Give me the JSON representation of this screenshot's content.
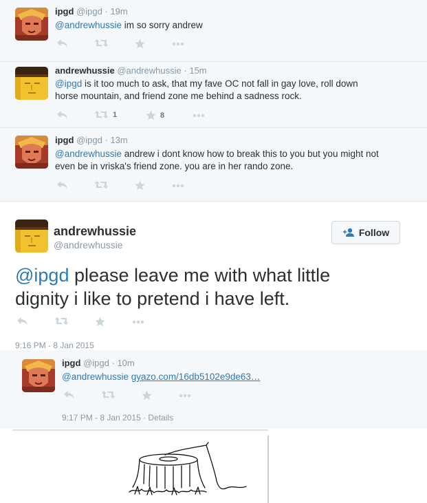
{
  "thread": [
    {
      "name": "ipgd",
      "handle": "@ipgd",
      "time": "19m",
      "mention": "@andrewhussie",
      "text": " im so sorry andrew",
      "retweets": "",
      "favorites": ""
    },
    {
      "name": "andrewhussie",
      "handle": "@andrewhussie",
      "time": "15m",
      "mention": "@ipgd",
      "text_line1": " is it too much to ask, that my fave OC not fall in gay love, roll down",
      "text_line2": "horse mountain, and friend zone me behind a sadness rock.",
      "retweets": "1",
      "favorites": "8"
    },
    {
      "name": "ipgd",
      "handle": "@ipgd",
      "time": "13m",
      "mention": "@andrewhussie",
      "text_line1": " andrew i dont know how to break this to you but you might not",
      "text_line2": "even be in vriska's friend zone. you are in her rando zone.",
      "retweets": "",
      "favorites": ""
    }
  ],
  "main": {
    "name": "andrewhussie",
    "handle": "@andrewhussie",
    "follow_label": "Follow",
    "mention": "@ipgd",
    "text_line1": " please leave me with what little",
    "text_line2": "dignity i like to pretend i have left.",
    "timestamp": "9:16 PM - 8 Jan 2015"
  },
  "reply": {
    "name": "ipgd",
    "handle": "@ipgd",
    "time": "10m",
    "mention": "@andrewhussie",
    "link": "gyazo.com/16db5102e9de63…",
    "timestamp": "9:17 PM - 8 Jan 2015 · Details"
  },
  "colors": {
    "link": "#2b7bb9",
    "muted": "#8899a6",
    "action": "#ccd6dd",
    "thread_bg": "#f5f8fa"
  },
  "icons": [
    "reply-icon",
    "retweet-icon",
    "favorite-icon",
    "more-icon",
    "follow-person-icon"
  ]
}
